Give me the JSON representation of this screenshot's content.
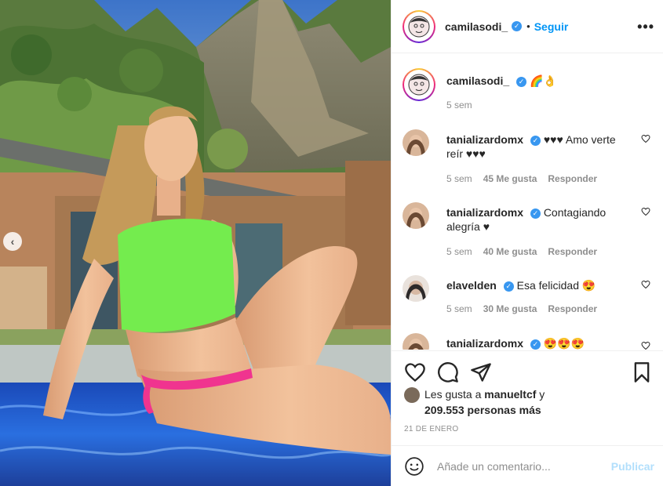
{
  "post": {
    "photo_alt": "",
    "prev_icon": "chevron-left-icon",
    "prev_glyph": "‹"
  },
  "header": {
    "username": "camilasodi_",
    "verified_glyph": "✓",
    "separator": "•",
    "follow_label": "Seguir",
    "more_glyph": "•••"
  },
  "caption": {
    "username": "camilasodi_",
    "text": "🌈👌",
    "time": "5 sem"
  },
  "comments": [
    {
      "username": "tanializardomx",
      "text": "♥♥♥ Amo verte reír ♥♥♥",
      "time": "5 sem",
      "likes": "45 Me gusta",
      "reply": "Responder"
    },
    {
      "username": "tanializardomx",
      "text": "Contagiando alegría ♥",
      "time": "5 sem",
      "likes": "40 Me gusta",
      "reply": "Responder"
    },
    {
      "username": "elavelden",
      "text": "Esa felicidad 😍",
      "time": "5 sem",
      "likes": "30 Me gusta",
      "reply": "Responder"
    },
    {
      "username": "tanializardomx",
      "text": "😍😍😍",
      "time": "",
      "likes": "",
      "reply": ""
    }
  ],
  "likes": {
    "prefix": "Les gusta a ",
    "liker": "manueltcf",
    "suffix": " y",
    "others": "209.553 personas más"
  },
  "date": "21 DE ENERO",
  "add_comment": {
    "placeholder": "Añade un comentario...",
    "publish_label": "Publicar"
  },
  "colors": {
    "accent": "#0095f6",
    "verified": "#3897f0",
    "publish_disabled": "#b2dffc",
    "muted": "#8e8e8e"
  },
  "icons": [
    "heart-icon",
    "comment-icon",
    "share-icon",
    "bookmark-icon",
    "emoji-icon",
    "more-icon",
    "verified-icon"
  ]
}
